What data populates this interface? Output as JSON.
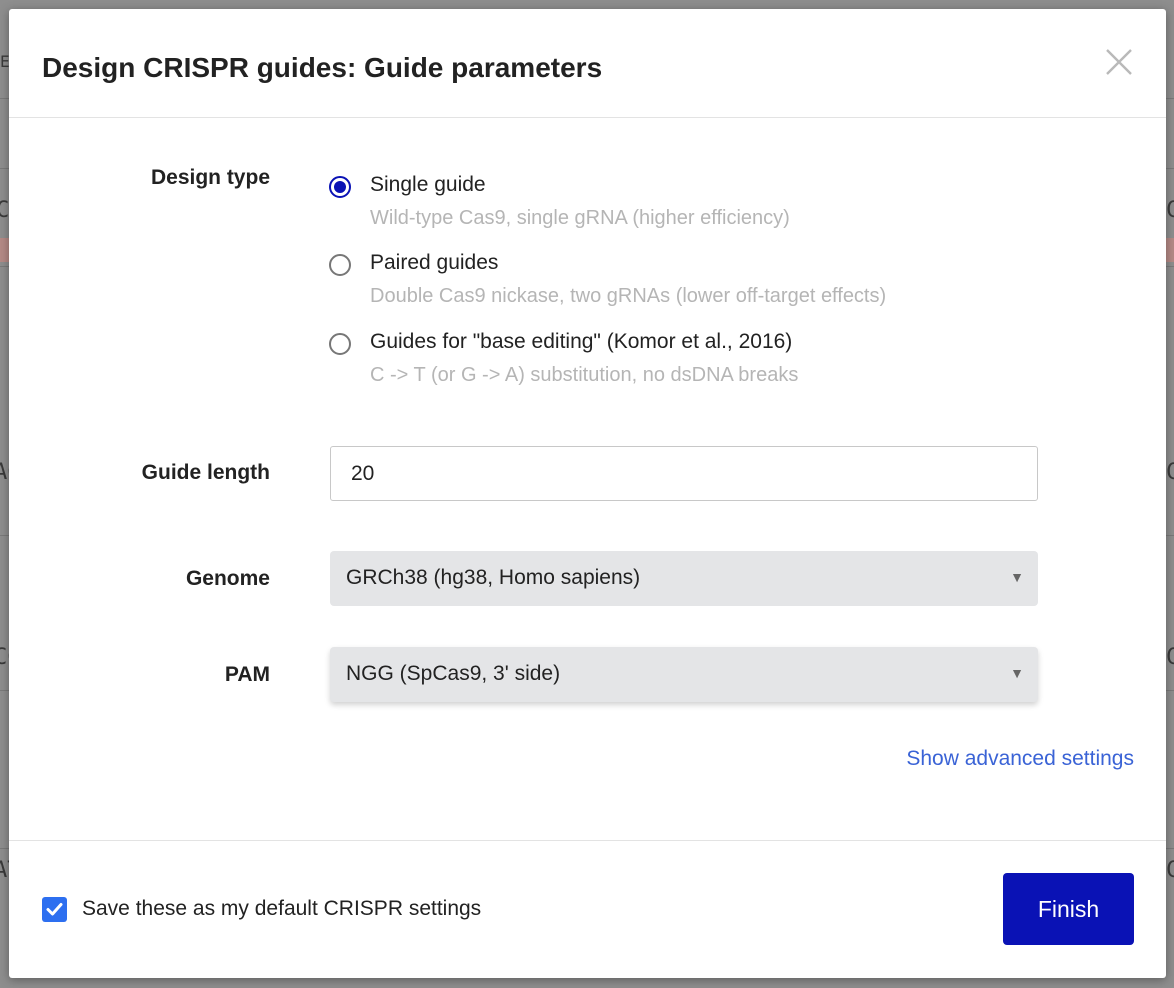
{
  "background": {
    "fragments": [
      "EL",
      "CA",
      "AC",
      "CC",
      "AT",
      "C",
      "C",
      "C",
      "C",
      "C"
    ]
  },
  "dialog": {
    "title": "Design CRISPR guides: Guide parameters",
    "close_icon": "close-icon"
  },
  "design_type": {
    "label": "Design type",
    "selected_index": 0,
    "options": [
      {
        "label": "Single guide",
        "description": "Wild-type Cas9, single gRNA (higher efficiency)"
      },
      {
        "label": "Paired guides",
        "description": "Double Cas9 nickase, two gRNAs (lower off-target effects)"
      },
      {
        "label": "Guides for \"base editing\" (Komor et al., 2016)",
        "description": "C -> T (or G -> A) substitution, no dsDNA breaks"
      }
    ]
  },
  "guide_length": {
    "label": "Guide length",
    "value": "20"
  },
  "genome": {
    "label": "Genome",
    "value": "GRCh38 (hg38, Homo sapiens)"
  },
  "pam": {
    "label": "PAM",
    "value": "NGG (SpCas9, 3' side)"
  },
  "advanced_link": "Show advanced settings",
  "footer": {
    "save_default_label": "Save these as my default CRISPR settings",
    "save_default_checked": true,
    "finish_label": "Finish"
  },
  "colors": {
    "accent": "#0a12b5",
    "link": "#3a63d6",
    "checkbox": "#2d6ff0",
    "muted_text": "#b5b5b5"
  }
}
